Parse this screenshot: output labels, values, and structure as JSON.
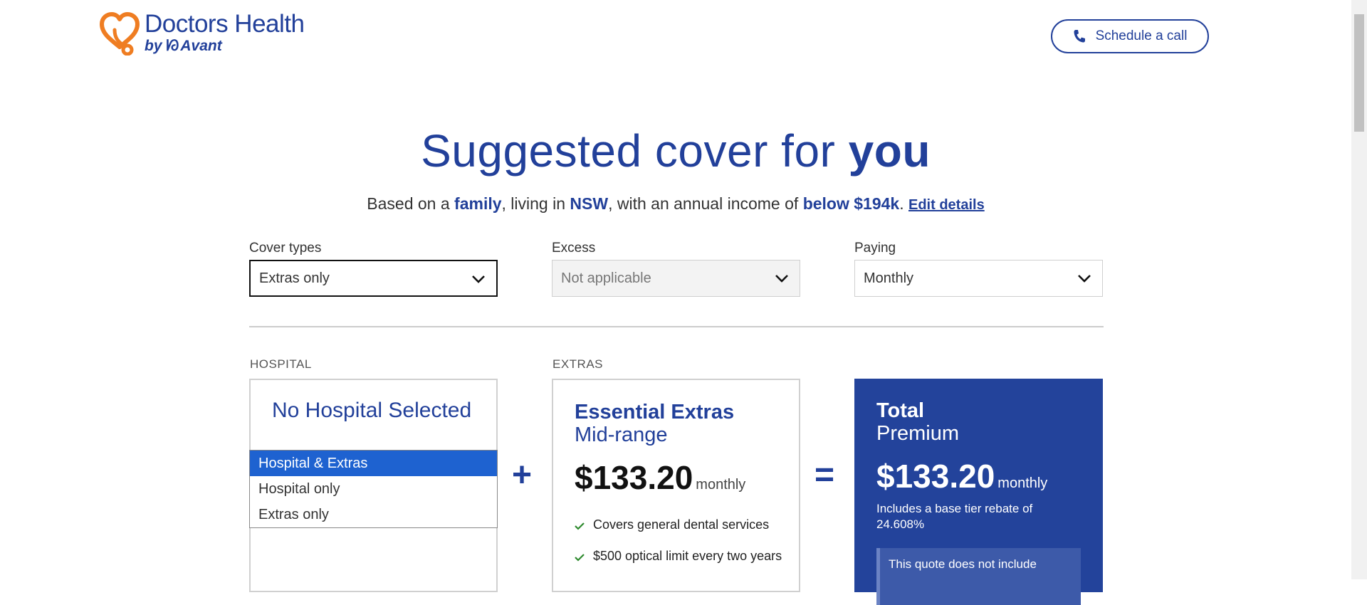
{
  "brand": {
    "name": "Doctors Health",
    "by": "by",
    "sub": "Avant",
    "colors": {
      "navy": "#22409a",
      "orange": "#ef7d22",
      "selected_blue": "#1e62d0"
    }
  },
  "header": {
    "call_button": "Schedule a call",
    "call_icon": "phone-icon"
  },
  "hero": {
    "title_light": "Suggested cover for ",
    "title_bold": "you",
    "sub_prefix": "Based on a ",
    "household": "family",
    "sub_mid1": ", living in ",
    "state": "NSW",
    "sub_mid2": ", with an annual income of ",
    "income": "below $194k",
    "sub_end": ".",
    "edit": "Edit details"
  },
  "filters": {
    "cover_types": {
      "label": "Cover types",
      "value": "Extras only"
    },
    "excess": {
      "label": "Excess",
      "value": "Not applicable"
    },
    "paying": {
      "label": "Paying",
      "value": "Monthly"
    }
  },
  "hospital": {
    "label": "HOSPITAL",
    "title": "No Hospital Selected",
    "dropdown_options": [
      "Hospital & Extras",
      "Hospital only",
      "Extras only"
    ]
  },
  "extras": {
    "label": "EXTRAS",
    "title": "Essential Extras",
    "tier": "Mid-range",
    "price": "$133.20",
    "unit": "monthly",
    "features": [
      "Covers general dental services",
      "$500 optical limit every two years"
    ]
  },
  "total": {
    "title": "Total",
    "subtitle": "Premium",
    "price": "$133.20",
    "unit": "monthly",
    "rebate": "Includes a base tier rebate of 24.608%",
    "note": "This quote does not include"
  },
  "operators": {
    "plus": "+",
    "equals": "="
  }
}
